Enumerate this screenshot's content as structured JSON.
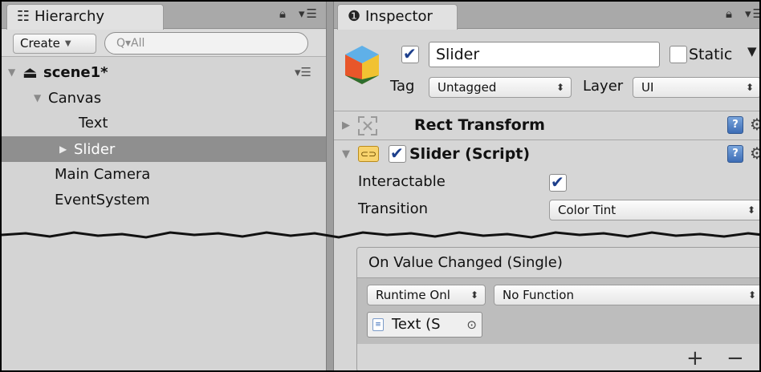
{
  "hierarchy": {
    "tab_title": "Hierarchy",
    "create_label": "Create",
    "search_placeholder": "Q▾All",
    "tree": [
      {
        "label": "scene1*",
        "depth": 0
      },
      {
        "label": "Canvas",
        "depth": 1
      },
      {
        "label": "Text",
        "depth": 2
      },
      {
        "label": "Slider",
        "depth": 2,
        "selected": true
      },
      {
        "label": "Main Camera",
        "depth": 1
      },
      {
        "label": "EventSystem",
        "depth": 1
      }
    ]
  },
  "inspector": {
    "tab_title": "Inspector",
    "object_name": "Slider",
    "active": true,
    "static_label": "Static",
    "tag_label": "Tag",
    "tag_value": "Untagged",
    "layer_label": "Layer",
    "layer_value": "UI",
    "components": {
      "rect_transform": {
        "title": "Rect Transform"
      },
      "slider": {
        "title": "Slider (Script)",
        "enabled": true,
        "props": {
          "interactable_label": "Interactable",
          "interactable_value": true,
          "transition_label": "Transition",
          "transition_value": "Color Tint"
        }
      }
    },
    "event": {
      "title": "On Value Changed (Single)",
      "runtime_value": "Runtime Onl",
      "function_value": "No Function",
      "object_value": "Text (S",
      "plus_label": "+",
      "minus_label": "−"
    }
  },
  "colors": {
    "selected_row": "#8f8f8f",
    "checkbox_check": "#1d3f8c",
    "help_blue": "#3d6db5"
  },
  "icons": {
    "hierarchy_tab": "list-icon",
    "inspector_tab": "info-icon",
    "scene": "unity-logo-icon",
    "gameobject": "cube-icon",
    "rect_transform": "rect-transform-icon",
    "script": "script-icon",
    "help": "help-book-icon",
    "settings": "gear-icon"
  }
}
